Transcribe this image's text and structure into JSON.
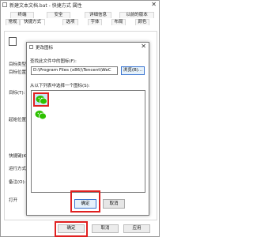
{
  "window": {
    "title": "新建文本文档.bat - 快捷方式 属性",
    "close_glyph": "✕"
  },
  "tabs": {
    "row1": [
      "终端",
      "安全",
      "详细信息",
      "以前的版本"
    ],
    "row2": [
      "常规",
      "快捷方式",
      "选项",
      "字体",
      "布局",
      "颜色"
    ]
  },
  "sidebar_labels": {
    "target_type": "目标类型",
    "target_location": "目标位置",
    "target": "目标(T):",
    "start_in": "起始位置",
    "shortcut_key": "快捷键(K):",
    "run": "运行方式",
    "comment": "备注(O):",
    "open": "打开"
  },
  "bottom_buttons": {
    "ok": "确定",
    "cancel": "取消",
    "apply": "应用"
  },
  "dialog": {
    "title": "更改图标",
    "close_glyph": "✕",
    "find_label": "查找此文件中的图标(F):",
    "path_value": "D:\\Program Files (x86)\\Tencent\\WeC",
    "browse_label": "浏览(B)...",
    "list_label": "从以下列表中选择一个图标(S):",
    "ok_label": "确定",
    "cancel_label": "取消",
    "icons": [
      "wechat-icon",
      "wechat-icon"
    ]
  },
  "colors": {
    "highlight": "#e02020",
    "wechat_green": "#2dc100",
    "accent": "#3a74d0"
  }
}
